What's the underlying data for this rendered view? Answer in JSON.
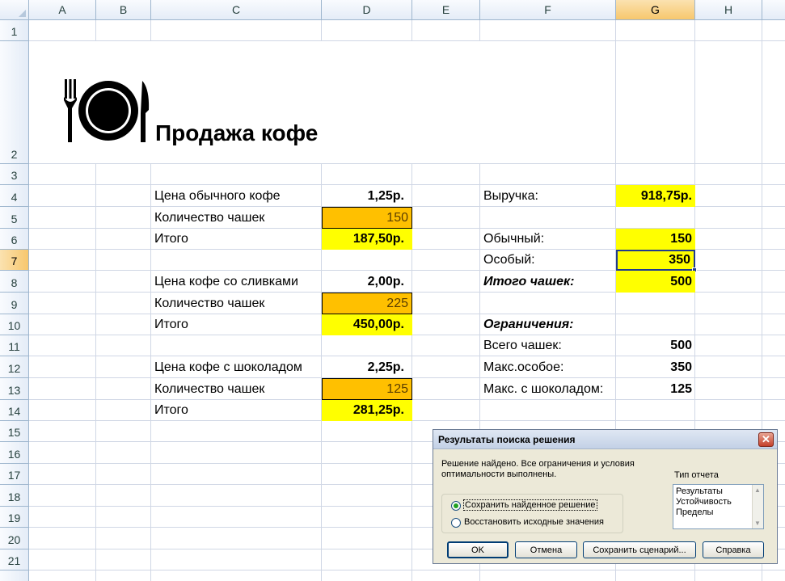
{
  "columns": [
    "A",
    "B",
    "C",
    "D",
    "E",
    "F",
    "G",
    "H"
  ],
  "selected_column": "G",
  "rows": [
    "1",
    "2",
    "3",
    "4",
    "5",
    "6",
    "7",
    "8",
    "9",
    "10",
    "11",
    "12",
    "13",
    "14",
    "15",
    "16",
    "17",
    "18",
    "19",
    "20",
    "21"
  ],
  "selected_row": "7",
  "icon": "restaurant-plate-icon",
  "title": "Продажа кофе",
  "left_table": {
    "r4": {
      "label": "Цена обычного кофе",
      "value": "1,25р."
    },
    "r5": {
      "label": "Количество чашек",
      "value": "150"
    },
    "r6": {
      "label": "Итого",
      "value": "187,50р."
    },
    "r8": {
      "label": "Цена кофе со сливками",
      "value": "2,00р."
    },
    "r9": {
      "label": "Количество чашек",
      "value": "225"
    },
    "r10": {
      "label": "Итого",
      "value": "450,00р."
    },
    "r12": {
      "label": "Цена кофе с шоколадом",
      "value": "2,25р."
    },
    "r13": {
      "label": "Количество чашек",
      "value": "125"
    },
    "r14": {
      "label": "Итого",
      "value": "281,25р."
    }
  },
  "right_table": {
    "r4": {
      "label": "Выручка:",
      "value": "918,75р."
    },
    "r6": {
      "label": "Обычный:",
      "value": "150"
    },
    "r7": {
      "label": "Особый:",
      "value": "350"
    },
    "r8": {
      "label": "Итого чашек:",
      "value": "500"
    },
    "r10": {
      "label": "Ограничения:"
    },
    "r11": {
      "label": "Всего чашек:",
      "value": "500"
    },
    "r12": {
      "label": "Макс.особое:",
      "value": "350"
    },
    "r13": {
      "label": "Макс. с шоколадом:",
      "value": "125"
    }
  },
  "colors": {
    "yellow": "#ffff00",
    "orange": "#ffc000",
    "selection": "#1f3b8f"
  },
  "dialog": {
    "title": "Результаты поиска решения",
    "message": "Решение найдено. Все ограничения и условия оптимальности выполнены.",
    "report_type_label": "Тип отчета",
    "reports": [
      "Результаты",
      "Устойчивость",
      "Пределы"
    ],
    "option_keep": "Сохранить найденное решение",
    "option_restore": "Восстановить исходные значения",
    "selected_option": "keep",
    "buttons": {
      "ok": "OK",
      "cancel": "Отмена",
      "save_scenario": "Сохранить сценарий...",
      "help": "Справка"
    }
  }
}
